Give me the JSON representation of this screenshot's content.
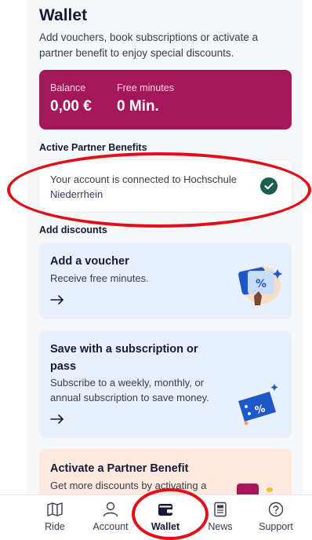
{
  "header": {
    "title": "Wallet",
    "subtitle": "Add vouchers, book subscriptions or activate a partner benefit to enjoy special discounts."
  },
  "balance": {
    "balance_label": "Balance",
    "balance_value": "0,00 €",
    "minutes_label": "Free minutes",
    "minutes_value": "0 Min.",
    "color": "#a4175a"
  },
  "partner_section": {
    "heading": "Active Partner Benefits",
    "text": "Your account is connected to Hochschule Niederrhein",
    "status_icon": "check-circle-icon"
  },
  "discounts": {
    "heading": "Add discounts",
    "cards": [
      {
        "title": "Add a voucher",
        "desc": "Receive free minutes.",
        "icon": "voucher-icon"
      },
      {
        "title": "Save with a subscription or pass",
        "desc": "Subscribe to a weekly, monthly, or annual subscription to save money.",
        "icon": "subscription-ticket-icon"
      },
      {
        "title": "Activate a Partner Benefit",
        "desc": "Get more discounts by activating a",
        "icon": "partner-icon"
      }
    ]
  },
  "tabbar": {
    "tabs": [
      {
        "label": "Ride",
        "icon": "map-icon",
        "active": false
      },
      {
        "label": "Account",
        "icon": "person-icon",
        "active": false
      },
      {
        "label": "Wallet",
        "icon": "wallet-icon",
        "active": true
      },
      {
        "label": "News",
        "icon": "news-icon",
        "active": false
      },
      {
        "label": "Support",
        "icon": "help-icon",
        "active": false
      }
    ]
  },
  "colors": {
    "accent": "#a4175a",
    "annotation_red": "#e0101a",
    "voucher_card_bg": "#e8f0fb",
    "partner_card_bg": "#fde9dd"
  }
}
